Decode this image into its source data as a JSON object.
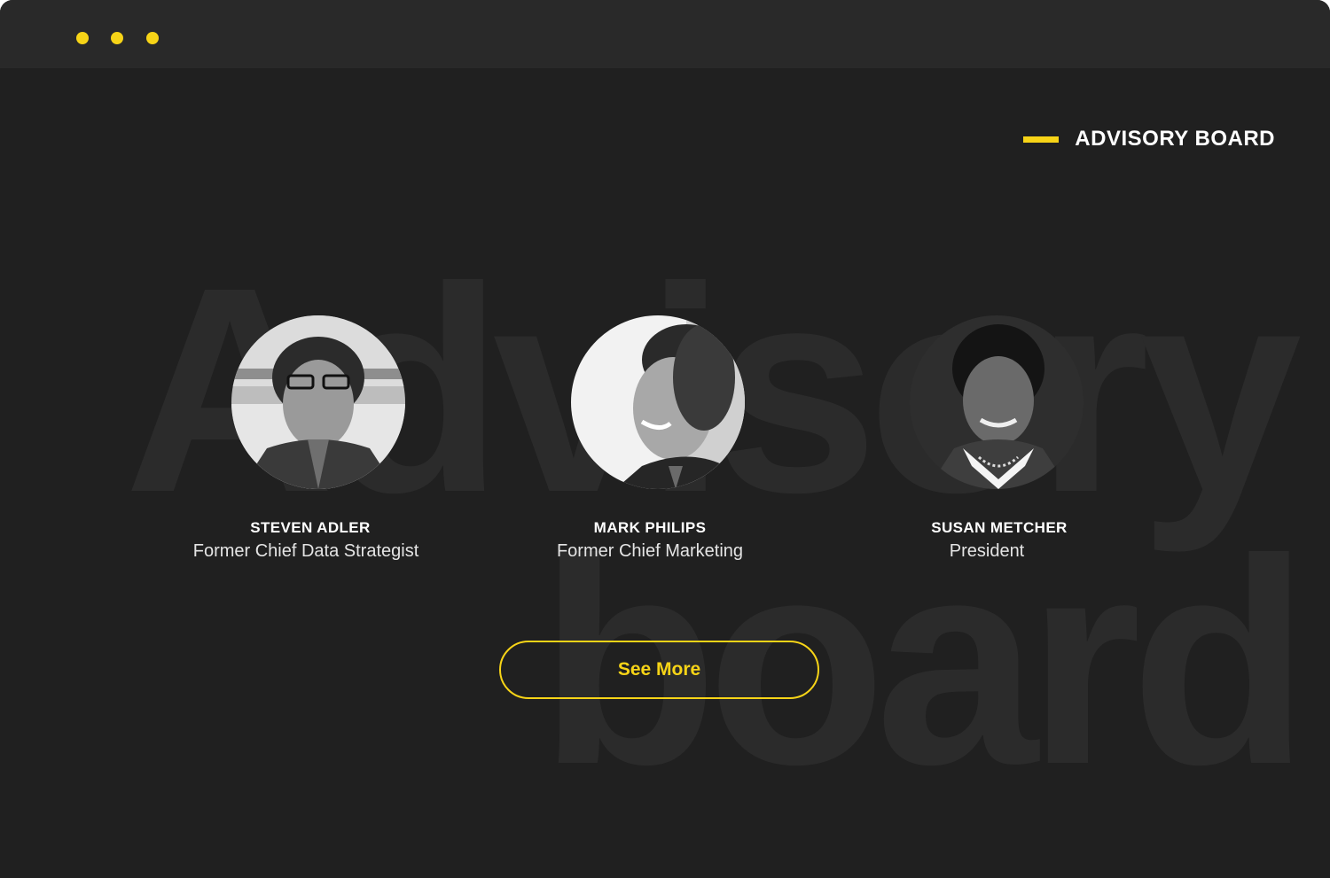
{
  "window": {
    "controls": [
      {
        "name": "window-dot-1",
        "color": "#f7d417"
      },
      {
        "name": "window-dot-2",
        "color": "#f7d417"
      },
      {
        "name": "window-dot-3",
        "color": "#f7d417"
      }
    ]
  },
  "colors": {
    "background": "#202020",
    "titlebar": "#292929",
    "accent": "#f7d417",
    "text": "#ffffff"
  },
  "background_text": {
    "line1": "Advisory",
    "line2": "board"
  },
  "section": {
    "title": "ADVISORY BOARD"
  },
  "members": [
    {
      "name": "STEVEN ADLER",
      "role": "Former Chief Data Strategist",
      "photo": "portrait-photo"
    },
    {
      "name": "MARK PHILIPS",
      "role": "Former Chief Marketing",
      "photo": "portrait-photo"
    },
    {
      "name": "SUSAN METCHER",
      "role": "President",
      "photo": "portrait-photo"
    }
  ],
  "cta": {
    "label": "See More"
  }
}
